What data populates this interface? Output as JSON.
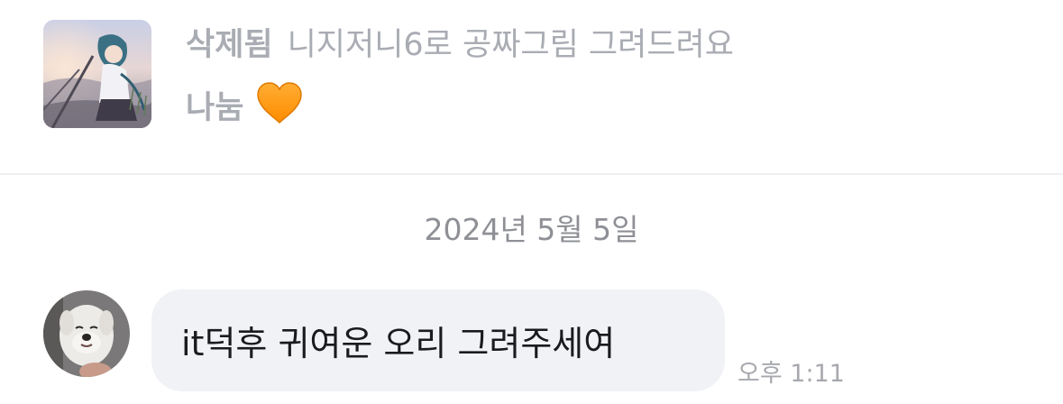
{
  "post": {
    "status_label": "삭제됨",
    "title": "니지저니6로 공짜그림 그려드려요",
    "subtitle": "나눔",
    "subtitle_emoji": "orange-heart-icon",
    "thumbnail": "anime-illustration-thumbnail"
  },
  "date_separator": "2024년 5월 5일",
  "message": {
    "avatar": "white-dog-photo-avatar",
    "text": "it덕후 귀여운 오리 그려주세여",
    "time": "오후 1:11"
  },
  "colors": {
    "muted_text": "#a9acb3",
    "bubble_bg": "#f1f2f6",
    "heart": "#ff9500",
    "divider": "#eeeff1"
  }
}
